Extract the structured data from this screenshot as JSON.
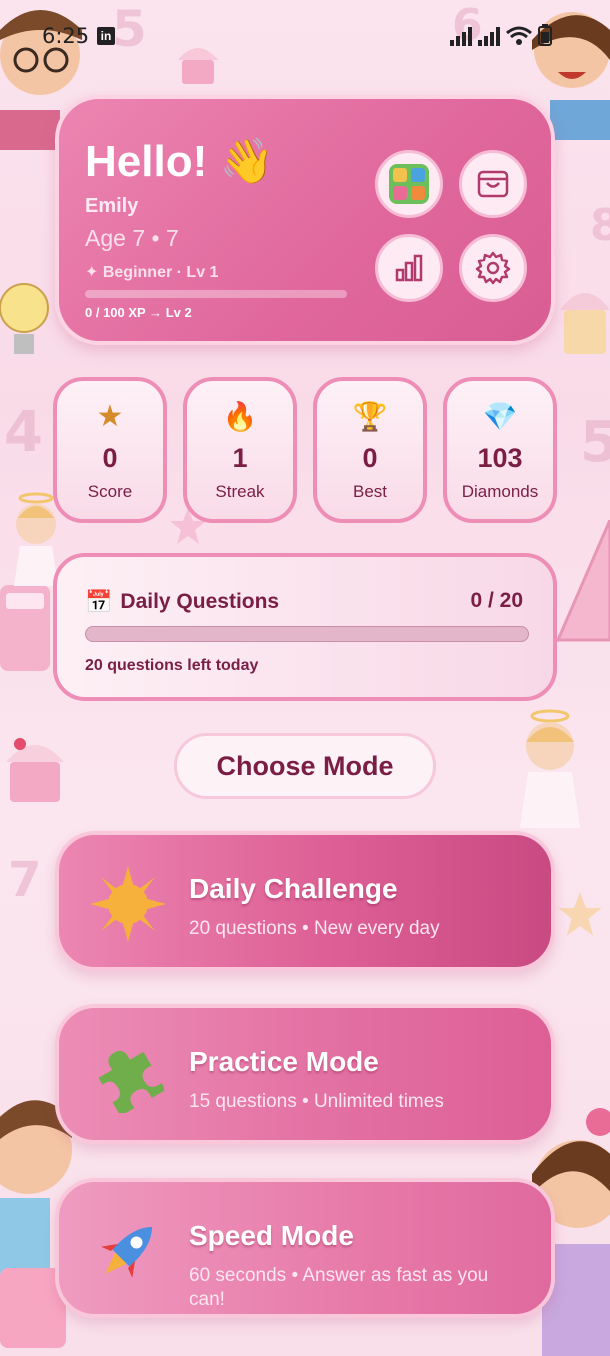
{
  "status_bar": {
    "time": "6:25",
    "app_badge": "in"
  },
  "profile": {
    "greeting": "Hello! 👋",
    "name": "Emily",
    "age": "Age 7 • 7",
    "level": "✦ Beginner · Lv 1",
    "xp": "0 / 100 XP → Lv 2",
    "xp_progress": 0
  },
  "header_buttons": [
    {
      "name": "game-map-icon"
    },
    {
      "name": "shop-bag-icon"
    },
    {
      "name": "stats-chart-icon"
    },
    {
      "name": "settings-gear-icon"
    }
  ],
  "stats": [
    {
      "icon": "★",
      "value": "0",
      "label": "Score"
    },
    {
      "icon": "🔥",
      "value": "1",
      "label": "Streak"
    },
    {
      "icon": "🏆",
      "value": "0",
      "label": "Best"
    },
    {
      "icon": "💎",
      "value": "103",
      "label": "Diamonds"
    }
  ],
  "daily_questions": {
    "icon": "📅",
    "title": "Daily Questions",
    "count": "0 / 20",
    "remaining": "20 questions left today",
    "progress": 0
  },
  "choose_mode": {
    "label": "Choose Mode"
  },
  "modes": [
    {
      "title": "Daily Challenge",
      "description": "20 questions • New every day",
      "icon": "star-icon"
    },
    {
      "title": "Practice Mode",
      "description": "15 questions • Unlimited times",
      "icon": "puzzle-icon"
    },
    {
      "title": "Speed Mode",
      "description": "60 seconds • Answer as fast as you can!",
      "icon": "rocket-icon"
    }
  ],
  "colors": {
    "accent": "#e0679c",
    "text": "#7a1e45",
    "card_border": "#ee8db6"
  }
}
